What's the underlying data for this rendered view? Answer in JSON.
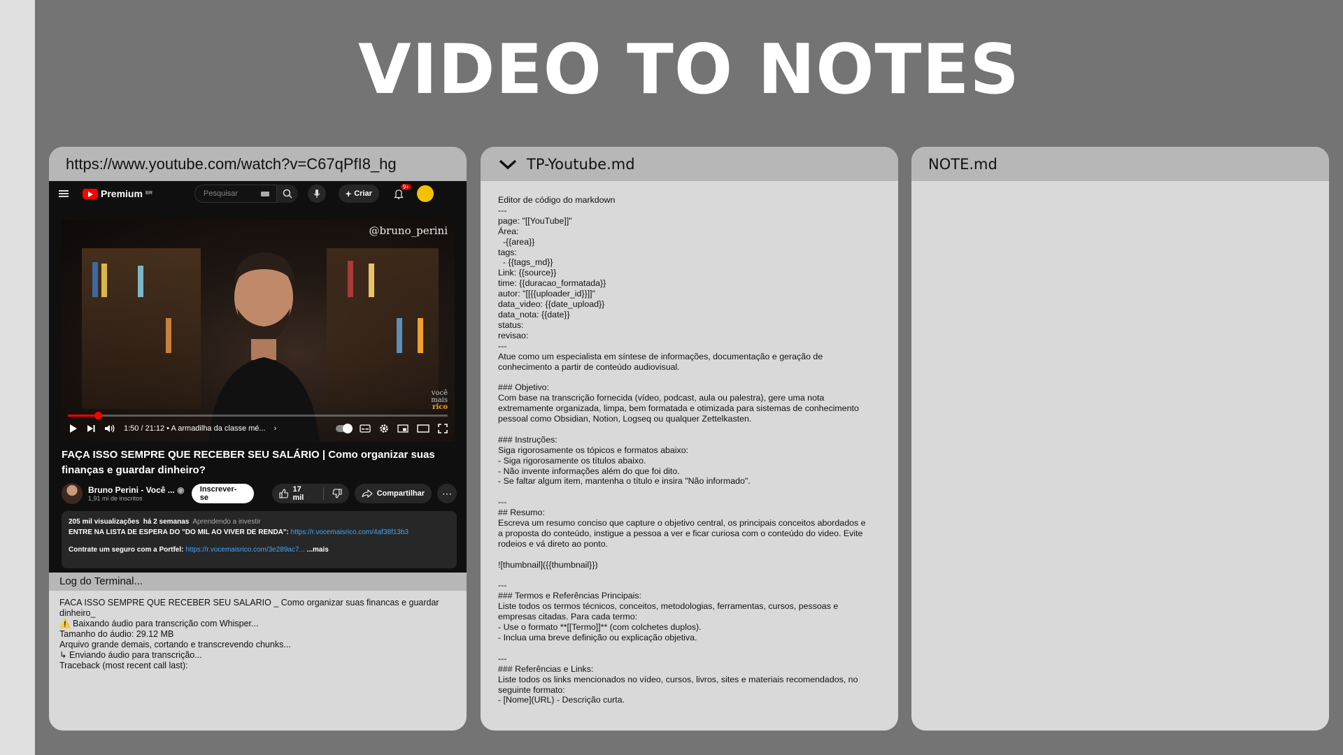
{
  "app": {
    "title": "VIDEO TO NOTES"
  },
  "video_panel": {
    "url": "https://www.youtube.com/watch?v=C67qPfI8_hg",
    "youtube": {
      "logo_text": "Premium",
      "region_badge": "BR",
      "search_placeholder": "Pesquisar",
      "create_label": "Criar",
      "notification_count": "9+",
      "watermark": "@bruno_perini",
      "brand_mark": [
        "você",
        "mais",
        "rico"
      ],
      "progress_fraction": 0.079,
      "time_display": "1:50 / 21:12 • A armadilha da classe mé...",
      "title": "FAÇA ISSO SEMPRE QUE RECEBER SEU SALÁRIO | Como organizar suas finanças e guardar dinheiro?",
      "channel_name": "Bruno Perini - Você ...",
      "subscribers": "1,91 mi de inscritos",
      "subscribe_label": "Inscrever-se",
      "likes": "17 mil",
      "share_label": "Compartilhar",
      "description": {
        "views": "205 mil visualizações",
        "ago": "há 2 semanas",
        "tag": "Aprendendo a investir",
        "line1_text": "ENTRE NA LISTA DE ESPERA DO \"DO MIL AO VIVER DE RENDA\":",
        "line1_link": "https://r.vocemaisrico.com/4af38f13b3",
        "line2_text": "Contrate um seguro com a Portfel:",
        "line2_link": "https://r.vocemaisrico.com/3e289ac7...",
        "more_label": "...mais"
      }
    },
    "log": {
      "title": "Log do Terminal...",
      "lines": [
        "FACA ISSO SEMPRE QUE RECEBER SEU SALARIO _ Como organizar suas financas e guardar",
        "dinheiro_",
        "⚠️ Baixando áudio para transcrição com Whisper...",
        "Tamanho do áudio: 29.12 MB",
        "Arquivo grande demais, cortando e transcrevendo chunks...",
        "↳ Enviando áudio para transcrição...",
        "Traceback (most recent call last):"
      ]
    }
  },
  "template_panel": {
    "title": "TP-Youtube.md",
    "lines": [
      "Editor de código do markdown",
      "---",
      "page: \"[[YouTube]]\"",
      "Área:",
      "  -{{area}}",
      "tags:",
      "  - {{tags_md}}",
      "Link: {{source}}",
      "time: {{duracao_formatada}}",
      "autor: \"[[{{uploader_id}}]]\"",
      "data_video: {{date_upload}}",
      "data_nota: {{date}}",
      "status:",
      "revisao:",
      "---",
      "Atue como um especialista em síntese de informações, documentação e geração de",
      "conhecimento a partir de conteúdo audiovisual.",
      "",
      "### Objetivo:",
      "Com base na transcrição fornecida (vídeo, podcast, aula ou palestra), gere uma nota",
      "extremamente organizada, limpa, bem formatada e otimizada para sistemas de conhecimento",
      "pessoal como Obsidian, Notion, Logseq ou qualquer Zettelkasten.",
      "",
      "### Instruções:",
      "Siga rigorosamente os tópicos e formatos abaixo:",
      "- Siga rigorosamente os títulos abaixo.",
      "- Não invente informações além do que foi dito.",
      "- Se faltar algum item, mantenha o título e insira \"Não informado\".",
      "",
      "---",
      "## Resumo:",
      "Escreva um resumo conciso que capture o objetivo central, os principais conceitos abordados e",
      "a proposta do conteúdo, instigue a pessoa a ver e ficar curiosa com o conteúdo do video. Evite",
      "rodeios e vá direto ao ponto.",
      "",
      "![thumbnail]({{thumbnail}})",
      "",
      "---",
      "### Termos e Referências Principais:",
      "Liste todos os termos técnicos, conceitos, metodologias, ferramentas, cursos, pessoas e",
      "empresas citadas. Para cada termo:",
      "- Use o formato **[[Termo]]** (com colchetes duplos).",
      "- Inclua uma breve definição ou explicação objetiva.",
      "",
      "---",
      "### Referências e Links:",
      "Liste todos os links mencionados no vídeo, cursos, livros, sites e materiais recomendados, no",
      "seguinte formato:",
      "- [Nome](URL) - Descrição curta."
    ]
  },
  "note_panel": {
    "title": "NOTE.md"
  }
}
